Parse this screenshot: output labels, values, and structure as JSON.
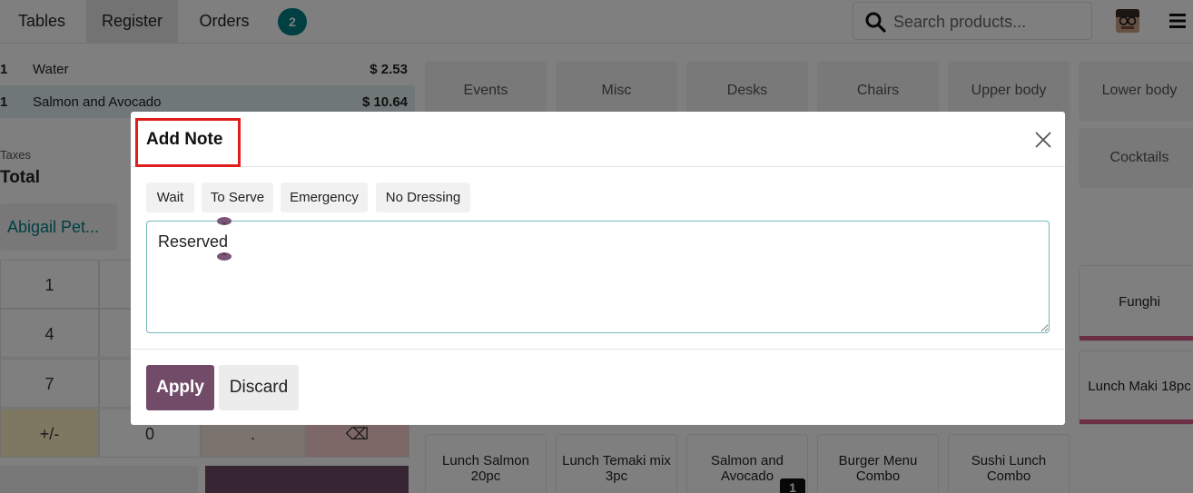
{
  "nav": {
    "tabs": [
      {
        "label": "Tables"
      },
      {
        "label": "Register"
      },
      {
        "label": "Orders"
      }
    ],
    "orders_count": "2",
    "search_placeholder": "Search products..."
  },
  "order": {
    "lines": [
      {
        "qty": "1",
        "name": "Water",
        "price": "$ 2.53"
      },
      {
        "qty": "1",
        "name": "Salmon and Avocado",
        "price": "$ 10.64"
      }
    ],
    "taxes_label": "Taxes",
    "total_label": "Total",
    "customer": "Abigail Pet..."
  },
  "numpad": {
    "keys": [
      "1",
      "4",
      "7",
      "+/-",
      "0",
      ".",
      "⌫"
    ]
  },
  "categories": [
    "Events",
    "Misc",
    "Desks",
    "Chairs",
    "Upper body",
    "Lower body",
    "Cocktails"
  ],
  "products": [
    {
      "name": "Funghi"
    },
    {
      "name": "Lunch Maki 18pc"
    },
    {
      "name": "Lunch Salmon 20pc"
    },
    {
      "name": "Lunch Temaki mix 3pc"
    },
    {
      "name": "Salmon and Avocado"
    },
    {
      "name": "Burger Menu Combo"
    },
    {
      "name": "Sushi Lunch Combo"
    }
  ],
  "product_qty_badge": "1",
  "dialog": {
    "title": "Add Note",
    "tags": [
      "Wait",
      "To Serve",
      "Emergency",
      "No Dressing"
    ],
    "note_value": "Reserved",
    "apply_label": "Apply",
    "discard_label": "Discard"
  },
  "colors": {
    "primary": "#714b67",
    "teal": "#017e84",
    "highlight": "#e01e1e"
  }
}
